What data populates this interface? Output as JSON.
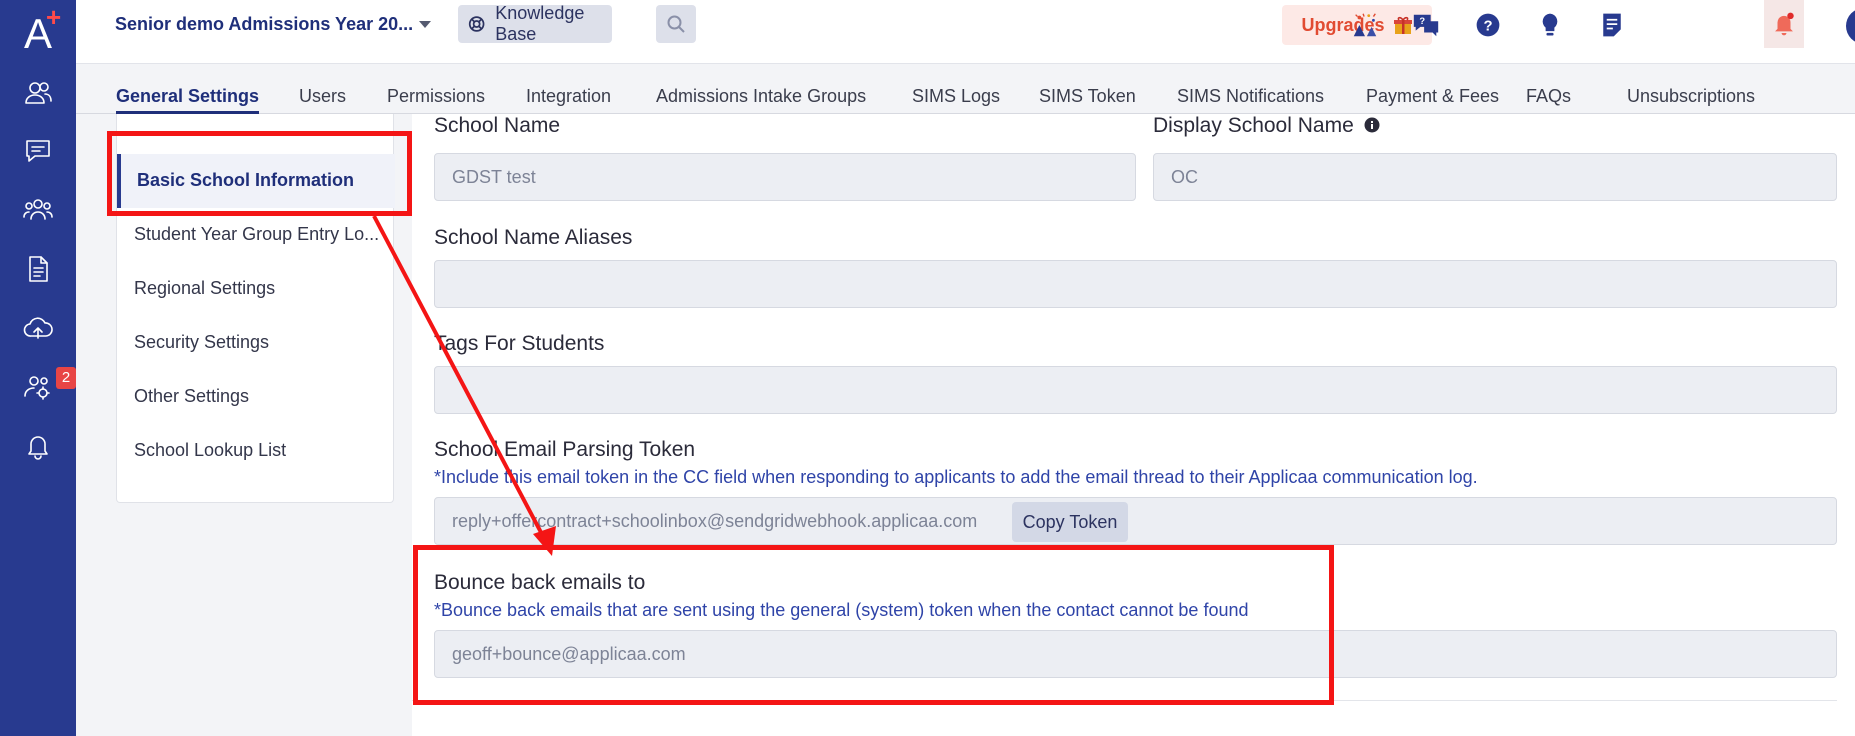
{
  "header": {
    "app_title": "Senior demo Admissions Year 20...",
    "knowledge_base_label": "Knowledge Base",
    "upgrades_label": "Upgrades"
  },
  "rail": {
    "logo": "A",
    "logo_plus": "+",
    "notification_count": "2",
    "icons": [
      "contacts-icon",
      "messages-icon",
      "groups-icon",
      "document-icon",
      "cloud-upload-icon",
      "settings-users-icon",
      "bell-icon"
    ]
  },
  "tabs": [
    "General Settings",
    "Users",
    "Permissions",
    "Integration",
    "Admissions Intake Groups",
    "SIMS Logs",
    "SIMS Token",
    "SIMS Notifications",
    "Payment & Fees",
    "FAQs",
    "Unsubscriptions"
  ],
  "sidenav": {
    "items": [
      "Basic School Information",
      "Student Year Group Entry Lo...",
      "Regional Settings",
      "Security Settings",
      "Other Settings",
      "School Lookup List"
    ]
  },
  "form": {
    "school_name_label": "School Name",
    "school_name_value": "GDST test",
    "display_school_name_label": "Display School Name",
    "display_school_name_value": "OC",
    "aliases_label": "School Name Aliases",
    "tags_label": "Tags For Students",
    "email_token_label": "School Email Parsing Token",
    "email_token_hint": "*Include this email token in the CC field when responding to applicants to add the email thread to their Applicaa communication log.",
    "email_token_value": "reply+offercontract+schoolinbox@sendgridwebhook.applicaa.com",
    "copy_token_label": "Copy Token",
    "bounce_label": "Bounce back emails to",
    "bounce_hint": "*Bounce back emails that are sent using the general (system) token when the contact cannot be found",
    "bounce_value": "geoff+bounce@applicaa.com"
  },
  "colors": {
    "rail": "#283a8f",
    "accent": "#1f2f7a",
    "annotation": "#f41515",
    "upgrades": "#e14b32"
  }
}
